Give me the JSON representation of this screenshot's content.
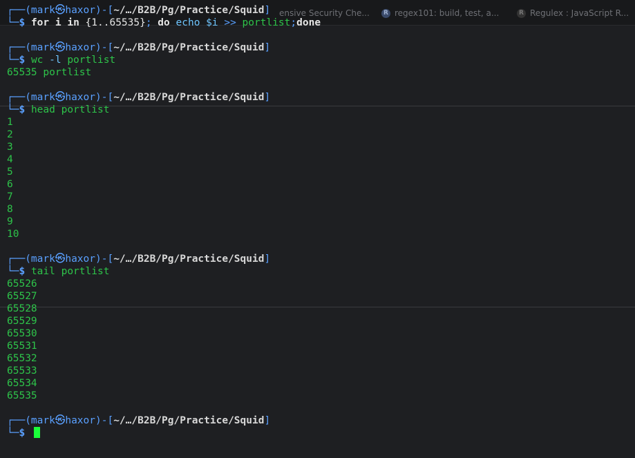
{
  "window": {
    "background_tabs": [
      {
        "label": "ensive Security Che...",
        "icon": "page-icon"
      },
      {
        "label": "regex101: build, test, a...",
        "icon": "regex101-icon"
      },
      {
        "label": "Regulex : JavaScript R...",
        "icon": "regulex-icon"
      }
    ]
  },
  "prompt": {
    "user": "mark",
    "host": "haxor",
    "separator_icon": "skull-icon",
    "cwd": "~/…/B2B/Pg/Practice/Squid",
    "symbol": "$"
  },
  "session": [
    {
      "command": {
        "segments": [
          {
            "text": "for",
            "style": "kw"
          },
          {
            "text": " i ",
            "style": "kw"
          },
          {
            "text": "in",
            "style": "kw"
          },
          {
            "text": " {1..65535}",
            "style": "num"
          },
          {
            "text": ";",
            "style": "op"
          },
          {
            "text": " do ",
            "style": "kw"
          },
          {
            "text": "echo",
            "style": "arg"
          },
          {
            "text": " $i ",
            "style": "arg"
          },
          {
            "text": ">>",
            "style": "op"
          },
          {
            "text": " portlist",
            "style": "word"
          },
          {
            "text": ";",
            "style": "op"
          },
          {
            "text": "done",
            "style": "kw"
          }
        ]
      },
      "output": []
    },
    {
      "command": {
        "segments": [
          {
            "text": "wc",
            "style": "word"
          },
          {
            "text": " -l ",
            "style": "arg"
          },
          {
            "text": "portlist",
            "style": "word"
          }
        ]
      },
      "output": [
        "65535 portlist"
      ]
    },
    {
      "command": {
        "segments": [
          {
            "text": "head",
            "style": "word"
          },
          {
            "text": " portlist",
            "style": "word"
          }
        ]
      },
      "output": [
        "1",
        "2",
        "3",
        "4",
        "5",
        "6",
        "7",
        "8",
        "9",
        "10"
      ]
    },
    {
      "command": {
        "segments": [
          {
            "text": "tail",
            "style": "word"
          },
          {
            "text": " portlist",
            "style": "word"
          }
        ]
      },
      "output": [
        "65526",
        "65527",
        "65528",
        "65529",
        "65530",
        "65531",
        "65532",
        "65533",
        "65534",
        "65535"
      ]
    }
  ],
  "colors": {
    "background": "#1e1f22",
    "prompt_frame": "#5aa0ff",
    "output_text": "#2ec44a",
    "cursor": "#1aff3a"
  }
}
